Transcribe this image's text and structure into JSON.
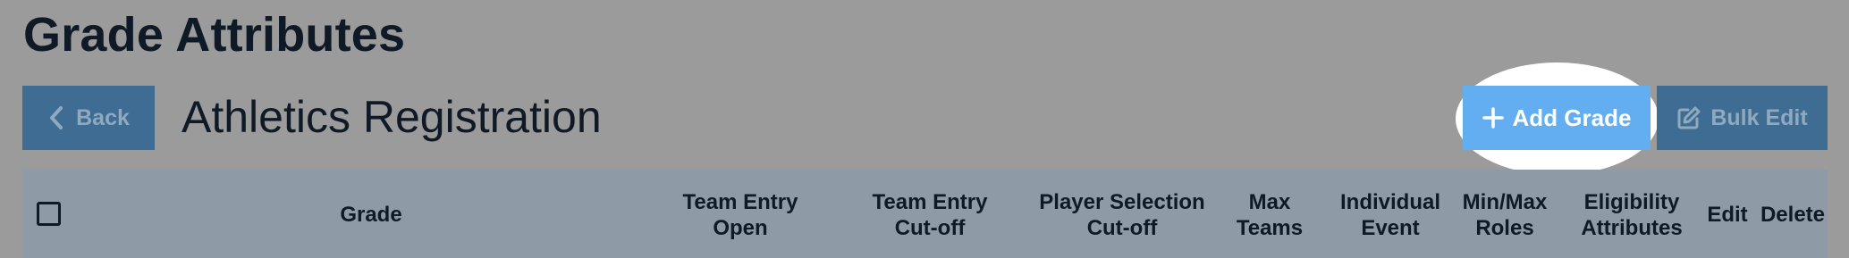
{
  "page": {
    "title": "Grade Attributes",
    "subtitle": "Athletics Registration"
  },
  "toolbar": {
    "back_label": "Back",
    "add_grade_label": "Add Grade",
    "bulk_edit_label": "Bulk Edit"
  },
  "icons": {
    "back": "chevron-left-icon",
    "add": "plus-icon",
    "bulk_edit": "edit-icon"
  },
  "table": {
    "columns": [
      {
        "line1": "Grade",
        "line2": ""
      },
      {
        "line1": "Team Entry",
        "line2": "Open"
      },
      {
        "line1": "Team Entry",
        "line2": "Cut-off"
      },
      {
        "line1": "Player Selection",
        "line2": "Cut-off"
      },
      {
        "line1": "Max",
        "line2": "Teams"
      },
      {
        "line1": "Individual",
        "line2": "Event"
      },
      {
        "line1": "Min/Max",
        "line2": "Roles"
      },
      {
        "line1": "Eligibility",
        "line2": "Attributes"
      },
      {
        "line1": "Edit",
        "line2": ""
      },
      {
        "line1": "Delete",
        "line2": ""
      }
    ]
  },
  "colors": {
    "overlay_background": "#9b9b9b",
    "button_dimmed": "#3f6c92",
    "highlight_button": "#63aef1",
    "table_header": "#8e9aa5",
    "text_dark": "#0f1a26"
  }
}
